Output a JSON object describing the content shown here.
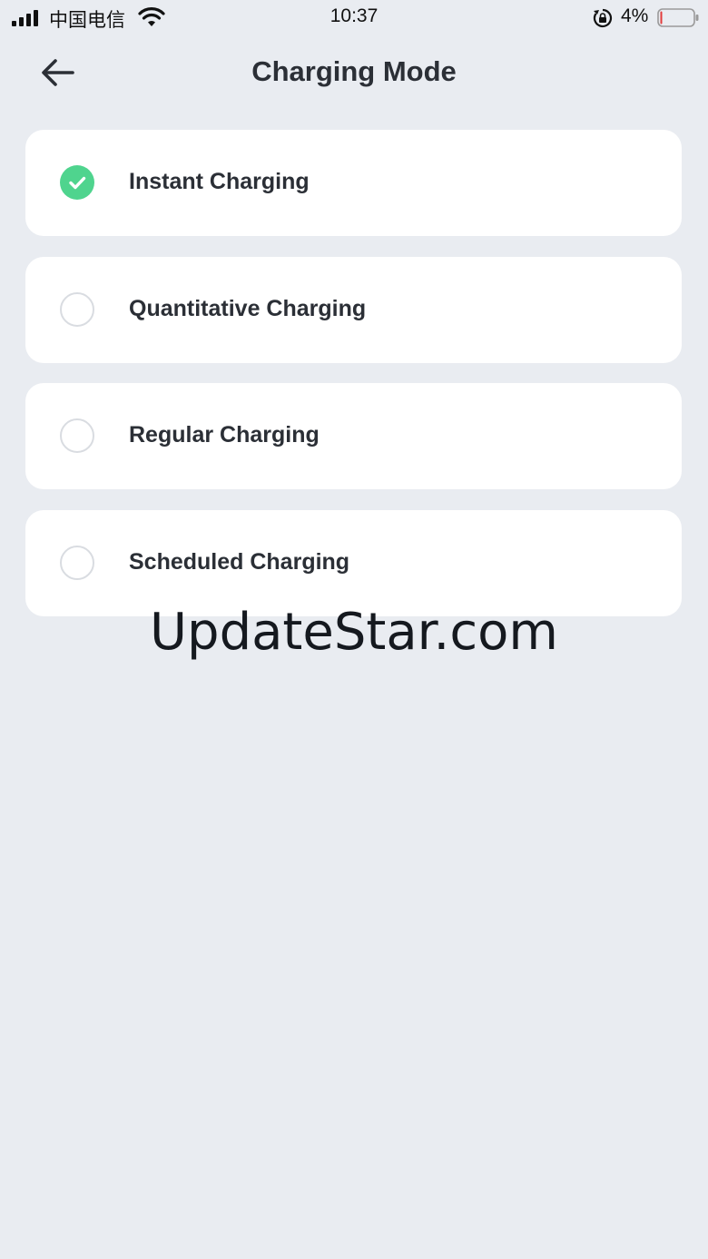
{
  "status_bar": {
    "carrier": "中国电信",
    "time": "10:37",
    "battery_percent": "4%",
    "battery_level": 0.04,
    "battery_color": "#e23b3b"
  },
  "header": {
    "title": "Charging Mode",
    "back_icon": "arrow-left-icon"
  },
  "options": [
    {
      "label": "Instant Charging",
      "selected": true
    },
    {
      "label": "Quantitative Charging",
      "selected": false
    },
    {
      "label": "Regular Charging",
      "selected": false
    },
    {
      "label": "Scheduled Charging",
      "selected": false
    }
  ],
  "colors": {
    "background": "#e9ecf1",
    "card": "#ffffff",
    "accent": "#4fd48e"
  },
  "watermark": "UpdateStar.com"
}
